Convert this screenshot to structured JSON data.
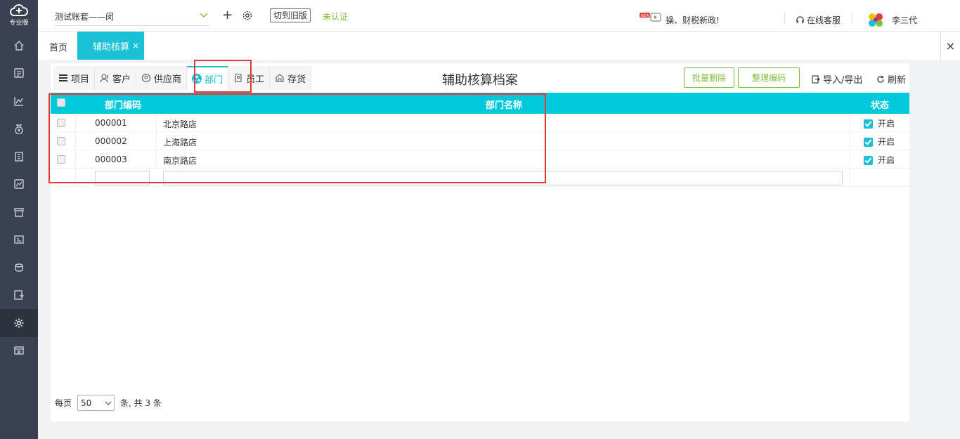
{
  "sidebar": {
    "logo_text": "专业版",
    "items": [
      {
        "icon": "home-icon"
      },
      {
        "icon": "voucher-icon"
      },
      {
        "icon": "report-chart-icon"
      },
      {
        "icon": "money-bag-icon"
      },
      {
        "icon": "ledger-icon"
      },
      {
        "icon": "analysis-icon"
      },
      {
        "icon": "invoice-icon"
      },
      {
        "icon": "asset-icon"
      },
      {
        "icon": "tax-icon"
      },
      {
        "icon": "export-icon"
      },
      {
        "icon": "settings-icon",
        "active": true
      },
      {
        "icon": "media-icon"
      }
    ]
  },
  "topbar": {
    "account_name": "测试账套——闵",
    "old_version_label": "切到旧版",
    "verify_status": "未认证",
    "news_text": "操、财税新政!",
    "service_label": "在线客服",
    "user_name": "李三代"
  },
  "tabs": {
    "home_label": "首页",
    "active_label": "辅助核算",
    "close_symbol": "×",
    "close_all_symbol": "×"
  },
  "categories": [
    {
      "label": "项目",
      "icon": "list-icon"
    },
    {
      "label": "客户",
      "icon": "customer-icon"
    },
    {
      "label": "供应商",
      "icon": "supplier-icon"
    },
    {
      "label": "部门",
      "icon": "department-icon",
      "active": true
    },
    {
      "label": "员工",
      "icon": "employee-icon"
    },
    {
      "label": "存货",
      "icon": "inventory-icon"
    }
  ],
  "page_title": "辅助核算档案",
  "toolbar": {
    "batch_delete_label": "批量删除",
    "reorder_code_label": "整理编码",
    "import_export_label": "导入/导出",
    "refresh_label": "刷新"
  },
  "table": {
    "headers": {
      "code": "部门编码",
      "name": "部门名称",
      "status": "状态"
    },
    "rows": [
      {
        "code": "000001",
        "name": "北京路店",
        "status": "开启"
      },
      {
        "code": "000002",
        "name": "上海路店",
        "status": "开启"
      },
      {
        "code": "000003",
        "name": "南京路店",
        "status": "开启"
      }
    ]
  },
  "pager": {
    "per_page_label": "每页",
    "per_page_value": "50",
    "total_text": "条, 共 3 条"
  },
  "colors": {
    "accent": "#1ac1d6",
    "header_bg": "#00c9dc",
    "sidebar_bg": "#3a4150",
    "green": "#7cc13b",
    "highlight": "#e53935"
  }
}
